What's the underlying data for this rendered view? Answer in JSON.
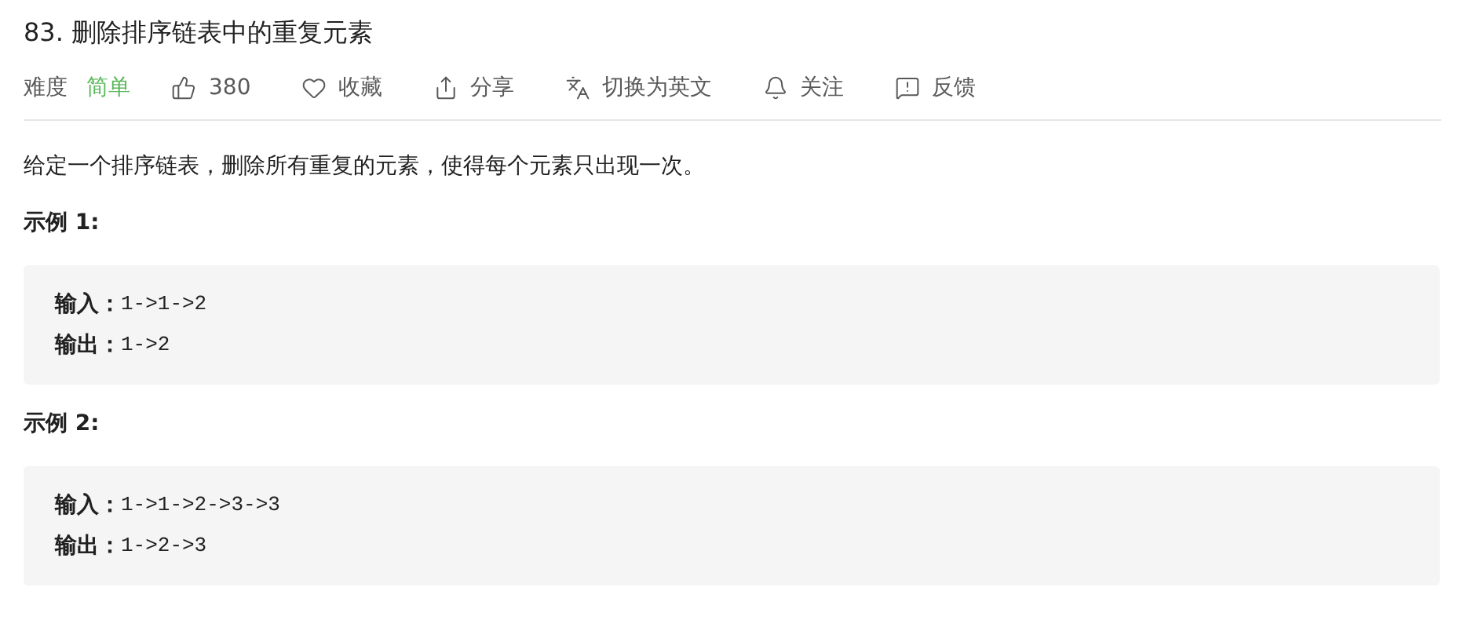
{
  "title": "83. 删除排序链表中的重复元素",
  "difficulty": {
    "label": "难度",
    "value": "简单"
  },
  "actions": [
    {
      "kind": "like",
      "label": "380"
    },
    {
      "kind": "favorite",
      "label": "收藏"
    },
    {
      "kind": "share",
      "label": "分享"
    },
    {
      "kind": "translate",
      "label": "切换为英文"
    },
    {
      "kind": "follow",
      "label": "关注"
    },
    {
      "kind": "feedback",
      "label": "反馈"
    }
  ],
  "description": "给定一个排序链表，删除所有重复的元素，使得每个元素只出现一次。",
  "examples": [
    {
      "heading": "示例 1:",
      "lines": [
        {
          "label": "输入：",
          "value": "1->1->2"
        },
        {
          "label": "输出：",
          "value": "1->2"
        }
      ]
    },
    {
      "heading": "示例 2:",
      "lines": [
        {
          "label": "输入：",
          "value": "1->1->2->3->3"
        },
        {
          "label": "输出：",
          "value": "1->2->3"
        }
      ]
    }
  ]
}
